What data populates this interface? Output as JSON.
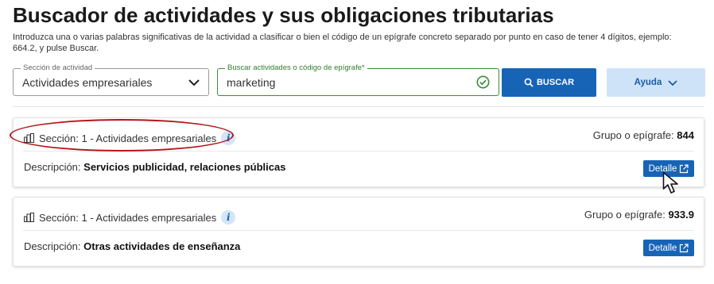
{
  "title": "Buscador de actividades y sus obligaciones tributarias",
  "intro": "Introduzca una o varias palabras significativas de la actividad a clasificar o bien el código de un epígrafe concreto separado por punto en caso de tener 4 dígitos, ejemplo: 664.2, y pulse Buscar.",
  "form": {
    "section_label": "Sección de actividad",
    "section_value": "Actividades empresariales",
    "search_label": "Buscar actividades o código de epígrafe*",
    "search_value": "marketing",
    "search_button": "BUSCAR",
    "help_button": "Ayuda"
  },
  "results": [
    {
      "section": "Sección: 1 - Actividades empresariales",
      "group_label": "Grupo o epígrafe:",
      "group_value": "844",
      "desc_label": "Descripción:",
      "desc_value": "Servicios publicidad, relaciones públicas",
      "detail_button": "Detalle"
    },
    {
      "section": "Sección: 1 - Actividades empresariales",
      "group_label": "Grupo o epígrafe:",
      "group_value": "933.9",
      "desc_label": "Descripción:",
      "desc_value": "Otras actividades de enseñanza",
      "detail_button": "Detalle"
    }
  ],
  "colors": {
    "primary": "#1764b7",
    "help_bg": "#cfe3f8",
    "valid": "#3a8c3a",
    "annotation": "#b5161b"
  },
  "icons": [
    "chevron-down-icon",
    "check-circle-icon",
    "search-icon",
    "building-icon",
    "info-icon",
    "external-link-icon",
    "pointer-cursor-icon"
  ]
}
